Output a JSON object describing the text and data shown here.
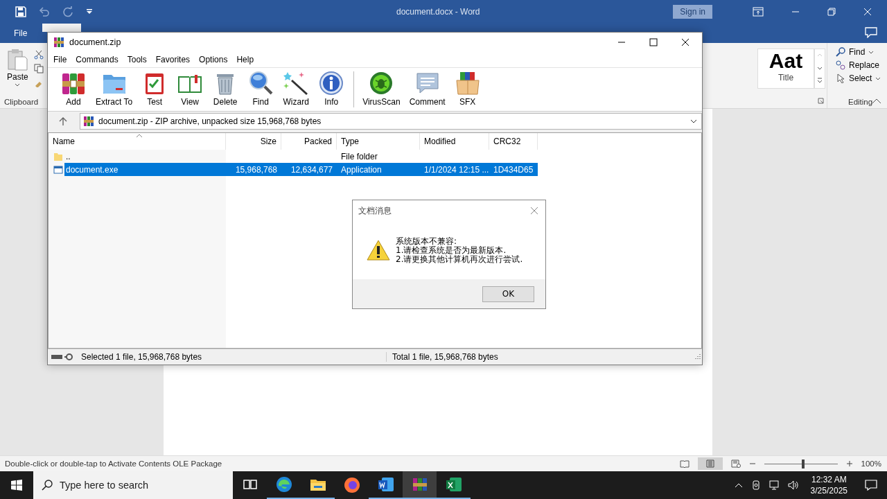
{
  "word": {
    "title": "document.docx  -  Word",
    "sign_in": "Sign in",
    "file_tab": "File",
    "ribbon": {
      "paste": "Paste",
      "clipboard": "Clipboard",
      "style_sample": "Aat",
      "style_name": "Title",
      "editing": [
        {
          "label": "Find",
          "dropdown": true
        },
        {
          "label": "Replace",
          "dropdown": false
        },
        {
          "label": "Select",
          "dropdown": true
        }
      ],
      "editing_label": "Editing"
    },
    "status": "Double-click or double-tap to Activate Contents OLE Package",
    "zoom": {
      "level": 0.53,
      "reading": "100%"
    }
  },
  "winrar": {
    "title": "document.zip",
    "menu": [
      "File",
      "Commands",
      "Tools",
      "Favorites",
      "Options",
      "Help"
    ],
    "commands": [
      {
        "kind": "add",
        "label": "Add"
      },
      {
        "kind": "extract",
        "label": "Extract To"
      },
      {
        "kind": "test",
        "label": "Test"
      },
      {
        "kind": "view",
        "label": "View"
      },
      {
        "kind": "delete",
        "label": "Delete"
      },
      {
        "kind": "find",
        "label": "Find"
      },
      {
        "kind": "wizard",
        "label": "Wizard"
      },
      {
        "kind": "info",
        "label": "Info"
      }
    ],
    "extras": [
      {
        "kind": "virusscan",
        "label": "VirusScan"
      },
      {
        "kind": "comment",
        "label": "Comment"
      },
      {
        "kind": "sfx",
        "label": "SFX"
      }
    ],
    "address": "document.zip - ZIP archive, unpacked size 15,968,768 bytes",
    "columns": [
      "Name",
      "Size",
      "Packed",
      "Type",
      "Modified",
      "CRC32"
    ],
    "rows": [
      {
        "kind": "folder",
        "name": "..",
        "type": "File folder",
        "selected": false
      },
      {
        "kind": "file",
        "name": "document.exe",
        "size": "15,968,768",
        "packed": "12,634,677",
        "type": "Application",
        "modified": "1/1/2024 12:15 ...",
        "crc32": "1D434D65",
        "selected": true
      }
    ],
    "status_left": "Selected 1 file, 15,968,768 bytes",
    "status_right": "Total 1 file, 15,968,768 bytes"
  },
  "dialog": {
    "title": "文档消息",
    "lines": [
      "系统版本不兼容:",
      "1.请检查系统是否为最新版本.",
      "2.请更换其他计算机再次进行尝试."
    ],
    "ok": "OK"
  },
  "taskbar": {
    "search_placeholder": "Type here to search",
    "apps": [
      {
        "kind": "taskview",
        "running": false,
        "active": false
      },
      {
        "kind": "edge",
        "running": true,
        "active": false
      },
      {
        "kind": "explorer",
        "running": true,
        "active": false
      },
      {
        "kind": "firefox",
        "running": false,
        "active": false
      },
      {
        "kind": "word",
        "running": true,
        "active": false
      },
      {
        "kind": "winrar",
        "running": true,
        "active": true
      },
      {
        "kind": "excel",
        "running": true,
        "active": false
      }
    ],
    "time": "12:32 AM",
    "date": "3/25/2025"
  }
}
